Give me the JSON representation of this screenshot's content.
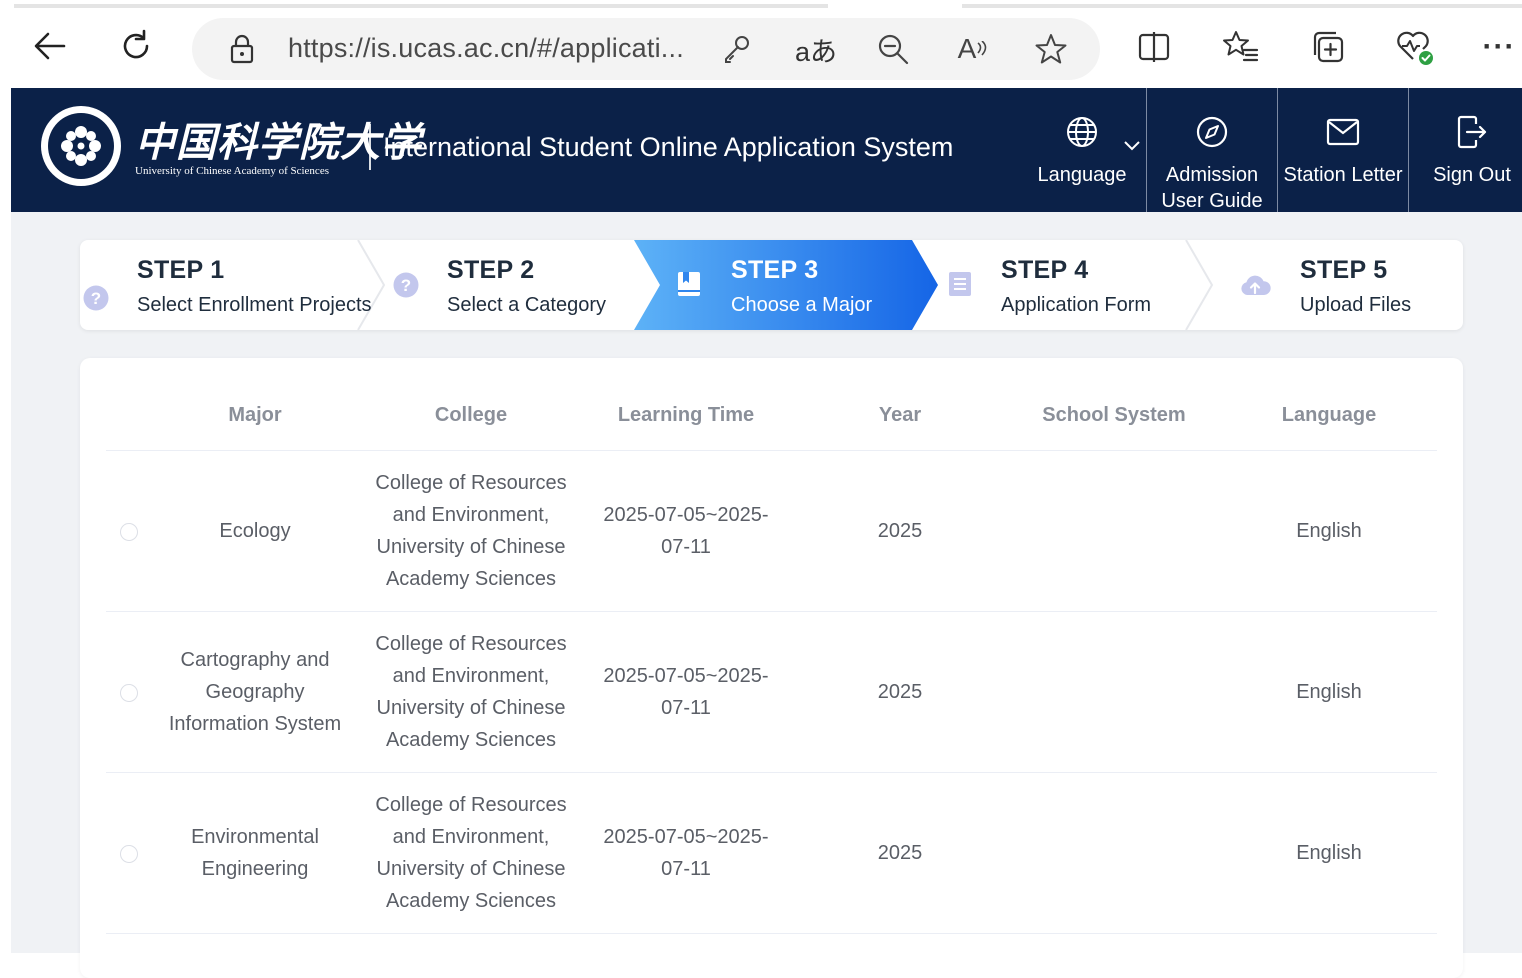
{
  "browser": {
    "url": "https://is.ucas.ac.cn/#/applicati...",
    "icons": [
      "back-arrow-icon",
      "refresh-icon",
      "lock-icon",
      "key-icon",
      "translate-icon",
      "zoom-out-icon",
      "read-aloud-icon",
      "favorite-star-icon",
      "split-screen-icon",
      "favorites-list-icon",
      "collections-icon",
      "browser-essentials-icon",
      "more-icon"
    ],
    "translate_glyph": "aあ",
    "read_aloud_glyph": "A",
    "more_glyph": "···"
  },
  "header": {
    "logo_cn": "中国科学院大学",
    "logo_en": "University of Chinese Academy of Sciences",
    "system_title": "International Student Online Application System",
    "nav": {
      "language": "Language",
      "guide_line1": "Admission",
      "guide_line2": "User Guide",
      "station_letter": "Station Letter",
      "sign_out": "Sign Out"
    },
    "background_color": "#0b2148"
  },
  "steps": [
    {
      "title": "STEP 1",
      "subtitle": "Select Enrollment Projects",
      "icon": "question-circle-icon"
    },
    {
      "title": "STEP 2",
      "subtitle": "Select a Category",
      "icon": "question-circle-icon"
    },
    {
      "title": "STEP 3",
      "subtitle": "Choose a Major",
      "icon": "book-icon",
      "active": true
    },
    {
      "title": "STEP 4",
      "subtitle": "Application Form",
      "icon": "form-icon"
    },
    {
      "title": "STEP 5",
      "subtitle": "Upload Files",
      "icon": "cloud-upload-icon"
    }
  ],
  "active_step_color": "#1f78ee",
  "table": {
    "columns": [
      "Major",
      "College",
      "Learning Time",
      "Year",
      "School System",
      "Language"
    ],
    "rows": [
      {
        "major": "Ecology",
        "college": "College of Resources and Environment, University of Chinese Academy Sciences",
        "learning_time": "2025-07-05~2025-07-11",
        "year": "2025",
        "school_system": "",
        "language": "English"
      },
      {
        "major": "Cartography and Geography Information System",
        "college": "College of Resources and Environment, University of Chinese Academy Sciences",
        "learning_time": "2025-07-05~2025-07-11",
        "year": "2025",
        "school_system": "",
        "language": "English"
      },
      {
        "major": "Environmental Engineering",
        "college": "College of Resources and Environment, University of Chinese Academy Sciences",
        "learning_time": "2025-07-05~2025-07-11",
        "year": "2025",
        "school_system": "",
        "language": "English"
      }
    ]
  }
}
